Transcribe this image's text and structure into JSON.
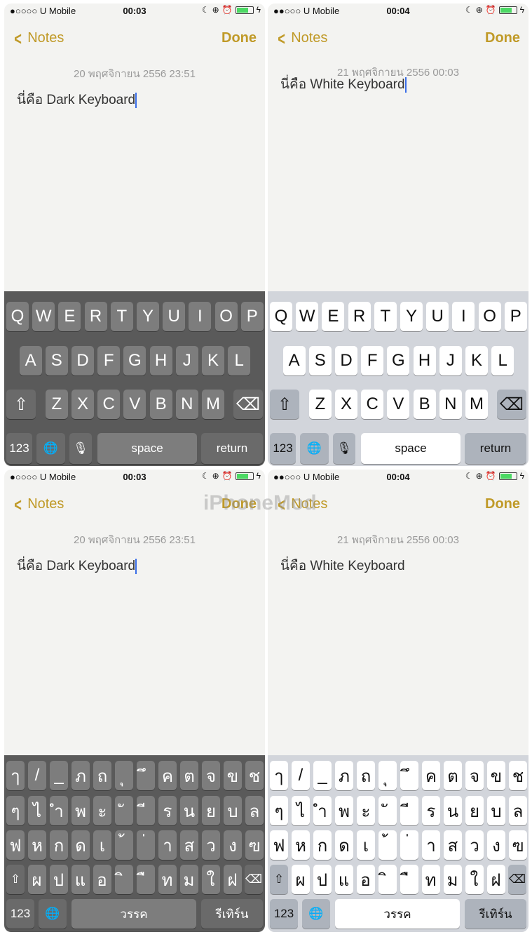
{
  "watermark": "iPhoneMod",
  "colors": {
    "accent": "#c09a28",
    "cursor": "#3a6ee8",
    "dark_kb": "#5a5a5a",
    "light_kb": "#d2d5db"
  },
  "panels": [
    {
      "theme": "dark",
      "layout": "en",
      "carrier": "●○○○○ U Mobile",
      "time": "00:03",
      "back": "Notes",
      "done": "Done",
      "date": "20 พฤศจิกายน 2556 23:51",
      "text": "นี่คือ Dark Keyboard",
      "cursor": true
    },
    {
      "theme": "light",
      "layout": "en",
      "carrier": "●●○○○ U Mobile",
      "time": "00:04",
      "back": "Notes",
      "done": "Done",
      "date": "21 พฤศจิกายน 2556 00:03",
      "text": "นี่คือ White Keyboard",
      "cursor": true
    },
    {
      "theme": "dark",
      "layout": "th",
      "carrier": "●○○○○ U Mobile",
      "time": "00:03",
      "back": "Notes",
      "done": "Done",
      "date": "20 พฤศจิกายน 2556 23:51",
      "text": "นี่คือ Dark Keyboard",
      "cursor": true
    },
    {
      "theme": "light",
      "layout": "th",
      "carrier": "●●○○○ U Mobile",
      "time": "00:04",
      "back": "Notes",
      "done": "Done",
      "date": "21 พฤศจิกายน 2556 00:03",
      "text": "นี่คือ White Keyboard",
      "cursor": false
    }
  ],
  "keyboards": {
    "en": {
      "rows": [
        [
          "Q",
          "W",
          "E",
          "R",
          "T",
          "Y",
          "U",
          "I",
          "O",
          "P"
        ],
        [
          "A",
          "S",
          "D",
          "F",
          "G",
          "H",
          "J",
          "K",
          "L"
        ],
        [
          "Z",
          "X",
          "C",
          "V",
          "B",
          "N",
          "M"
        ]
      ],
      "shift": "⇧",
      "delete": "⌫",
      "numbers": "123",
      "globe": "🌐",
      "mic": "🎙",
      "space": "space",
      "return": "return"
    },
    "th": {
      "rows": [
        [
          "ๅ",
          "/",
          "_",
          "ภ",
          "ถ",
          "ุ",
          "ึ",
          "ค",
          "ต",
          "จ",
          "ข",
          "ช"
        ],
        [
          "ๆ",
          "ไ",
          "ำ",
          "พ",
          "ะ",
          "ั",
          "ี",
          "ร",
          "น",
          "ย",
          "บ",
          "ล"
        ],
        [
          "ฟ",
          "ห",
          "ก",
          "ด",
          "เ",
          "้",
          "่",
          "า",
          "ส",
          "ว",
          "ง",
          "ฃ"
        ],
        [
          "ผ",
          "ป",
          "แ",
          "อ",
          "ิ",
          "ื",
          "ท",
          "ม",
          "ใ",
          "ฝ"
        ]
      ],
      "shift": "⇧",
      "delete": "⌫",
      "numbers": "123",
      "globe": "🌐",
      "space": "วรรค",
      "return": "รีเทิร์น"
    }
  }
}
